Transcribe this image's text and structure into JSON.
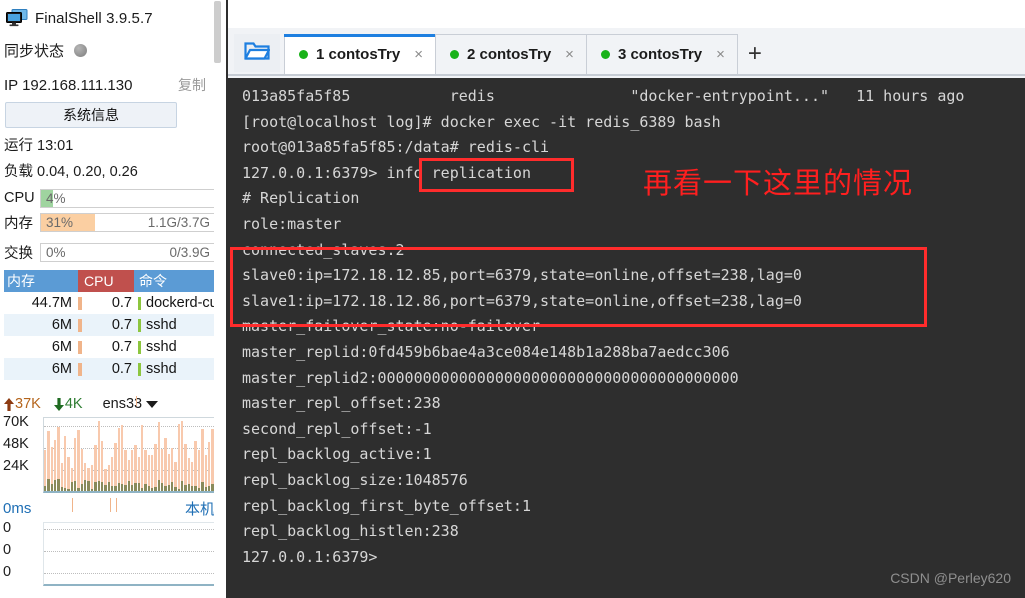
{
  "app": {
    "title": "FinalShell 3.9.5.7",
    "icon": "monitor-icon"
  },
  "sidebar": {
    "sync": {
      "label": "同步状态",
      "status_icon": "status-dot"
    },
    "ip": {
      "text": "IP 192.168.111.130",
      "copy_label": "复制"
    },
    "system_info_button": "系统信息",
    "uptime": "运行 13:01",
    "load": "负载 0.04, 0.20, 0.26",
    "meters": [
      {
        "name": "cpu",
        "label": "CPU",
        "percent": "4%",
        "fill_pct": 7,
        "color": "#9fd49f",
        "right": ""
      },
      {
        "name": "mem",
        "label": "内存",
        "percent": "31%",
        "fill_pct": 31,
        "color": "#fbcfa2",
        "right": "1.1G/3.7G"
      },
      {
        "name": "swap",
        "label": "交换",
        "percent": "0%",
        "fill_pct": 0,
        "color": "#fbcfa2",
        "right": "0/3.9G"
      }
    ],
    "process_table": {
      "columns": [
        "内存",
        "CPU",
        "命令"
      ],
      "rows": [
        {
          "mem": "44.7M",
          "cpu": "0.7",
          "cmd": "dockerd-cur..."
        },
        {
          "mem": "6M",
          "cpu": "0.7",
          "cmd": "sshd"
        },
        {
          "mem": "6M",
          "cpu": "0.7",
          "cmd": "sshd"
        },
        {
          "mem": "6M",
          "cpu": "0.7",
          "cmd": "sshd"
        }
      ]
    },
    "network": {
      "upload": "37K",
      "download": "4K",
      "interface": "ens33",
      "y_ticks": [
        "70K",
        "48K",
        "24K"
      ]
    },
    "latency": {
      "label": "0ms",
      "host_label": "本机",
      "y_ticks": [
        "0",
        "0",
        "0"
      ]
    }
  },
  "tabbar": {
    "folder_icon": "open-folder-icon",
    "add_label": "+",
    "tabs": [
      {
        "label": "1 contosTry",
        "active": true
      },
      {
        "label": "2 contosTry",
        "active": false
      },
      {
        "label": "3 contosTry",
        "active": false
      }
    ],
    "close_glyph": "×"
  },
  "terminal": {
    "lines": [
      "013a85fa5f85           redis               \"docker-entrypoint...\"   11 hours ago",
      "[root@localhost log]# docker exec -it redis_6389 bash",
      "root@013a85fa5f85:/data# redis-cli",
      "127.0.0.1:6379> info replication",
      "# Replication",
      "role:master",
      "connected_slaves:2",
      "slave0:ip=172.18.12.85,port=6379,state=online,offset=238,lag=0",
      "slave1:ip=172.18.12.86,port=6379,state=online,offset=238,lag=0",
      "master_failover_state:no-failover",
      "master_replid:0fd459b6bae4a3ce084e148b1a288ba7aedcc306",
      "master_replid2:0000000000000000000000000000000000000000",
      "master_repl_offset:238",
      "second_repl_offset:-1",
      "repl_backlog_active:1",
      "repl_backlog_size:1048576",
      "repl_backlog_first_byte_offset:1",
      "repl_backlog_histlen:238",
      "127.0.0.1:6379>"
    ],
    "annotation": "再看一下这里的情况",
    "watermark": "CSDN @Perley620",
    "highlight_color": "#ff2c2c"
  }
}
